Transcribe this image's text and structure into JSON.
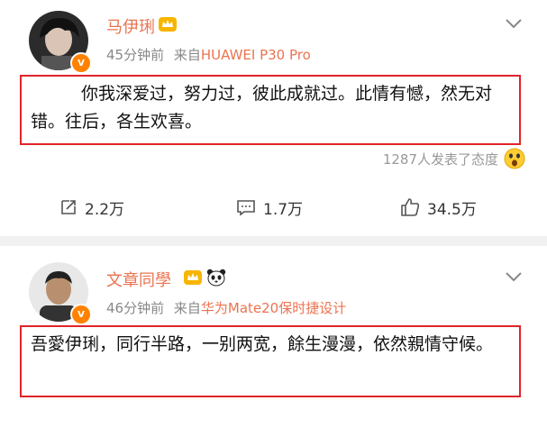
{
  "post1": {
    "username": "马伊琍",
    "time": "45分钟前",
    "source_prefix": "来自",
    "source": "HUAWEI P30 Pro",
    "content": "你我深爱过，努力过，彼此成就过。此情有憾，然无对错。往后，各生欢喜。",
    "reaction_text": "1287人发表了态度",
    "repost_count": "2.2万",
    "comment_count": "1.7万",
    "like_count": "34.5万"
  },
  "post2": {
    "username": "文章同學",
    "time": "46分钟前",
    "source_prefix": "来自",
    "source": "华为Mate20保时捷设计",
    "content": "吾愛伊琍，同行半路，一别两宽，餘生漫漫，依然親情守候。"
  },
  "colors": {
    "username": "#eb7350",
    "highlight_border": "#e0242a",
    "verified_badge": "#ff8200",
    "muted_text": "#888888",
    "divider": "#f1f1f1"
  },
  "icons": [
    "crown-icon",
    "verified-icon",
    "chevron-down-icon",
    "wow-emoji-icon",
    "repost-icon",
    "comment-icon",
    "like-icon",
    "panda-icon"
  ]
}
